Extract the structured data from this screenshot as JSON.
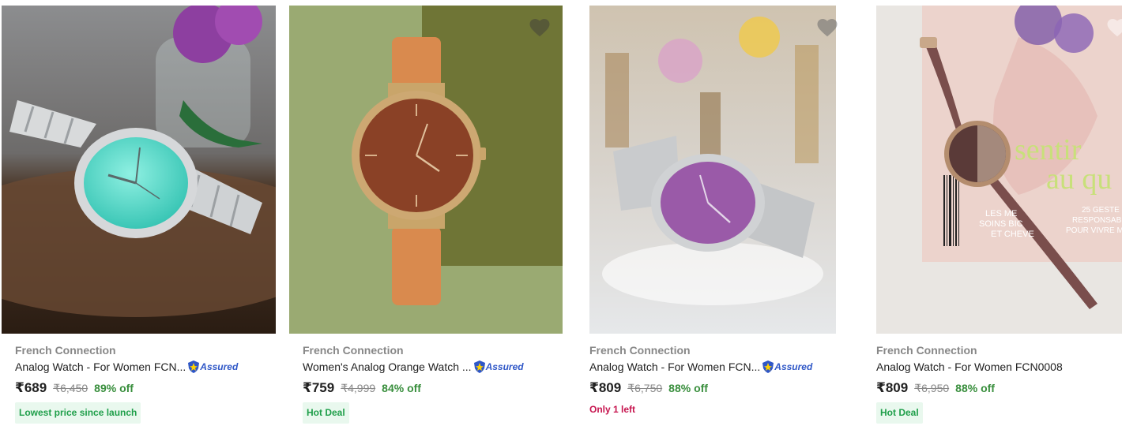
{
  "products": [
    {
      "brand": "French Connection",
      "title": "Analog Watch - For Women FCN...",
      "assured_label": "Assured",
      "price": "₹689",
      "mrp": "₹6,450",
      "discount": "89% off",
      "badge": "Lowest price since launch"
    },
    {
      "brand": "French Connection",
      "title": "Women's Analog Orange Watch ...",
      "assured_label": "Assured",
      "price": "₹759",
      "mrp": "₹4,999",
      "discount": "84% off",
      "badge": "Hot Deal"
    },
    {
      "brand": "French Connection",
      "title": "Analog Watch - For Women FCN...",
      "assured_label": "Assured",
      "price": "₹809",
      "mrp": "₹6,750",
      "discount": "88% off",
      "stock_note": "Only 1 left"
    },
    {
      "brand": "French Connection",
      "title": "Analog Watch - For Women FCN0008",
      "price": "₹809",
      "mrp": "₹6,950",
      "discount": "88% off",
      "badge": "Hot Deal"
    }
  ],
  "icons": {
    "wishlist": "heart-icon",
    "assured": "shield-icon"
  },
  "colors": {
    "brand_text": "#878787",
    "discount": "#388e3c",
    "badge_text": "#1f9f4a",
    "badge_bg": "#e9f8ee",
    "stock_note": "#c7154f",
    "assured": "#2f57c7"
  }
}
